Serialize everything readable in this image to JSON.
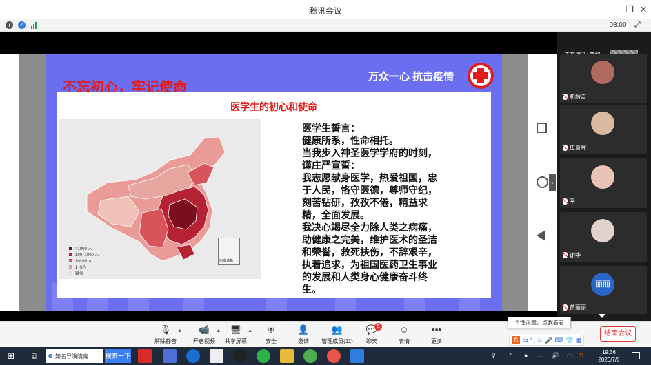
{
  "window": {
    "title": "腾讯会议"
  },
  "status": {
    "timer": "08:00"
  },
  "slide": {
    "title": "不忘初心，牢记使命",
    "slogan": "万众一心 抗击疫情",
    "panel_title": "医学生的初心和使命",
    "map_legend": [
      {
        "label": ">1000 人",
        "color": "#7a0e1e"
      },
      {
        "label": "100~1000 人",
        "color": "#b52234"
      },
      {
        "label": "10~99 人",
        "color": "#d8535a"
      },
      {
        "label": "1~9人",
        "color": "#eb9b97"
      },
      {
        "label": "疑似",
        "color": "#f6d7c9"
      }
    ],
    "inset_label": "南海诸岛",
    "oath_lines": [
      "医学生誓言：",
      "健康所系，性命相托。",
      "当我步入神圣医学学府的时刻，",
      "谨庄严宣誓：",
      "我志愿献身医学，热爱祖国，忠",
      "于人民，恪守医德，尊师守纪，",
      "刻苦钻研，孜孜不倦，精益求",
      "精，全面发展。",
      "我决心竭尽全力除人类之病痛，",
      "助健康之完美，维护医术的圣洁",
      "和荣誉，救死扶伤，不辞艰辛，",
      "执着追求，为祖国医药卫生事业",
      "的发展和人类身心健康奋斗终",
      "生。"
    ]
  },
  "sidebar": {
    "speaking_label": "正在讲话: 李旭",
    "participants": [
      {
        "name": "和娇吉",
        "avatar_color": "#b06a60"
      },
      {
        "name": "伍晋辉",
        "avatar_color": "#d9b9a2"
      },
      {
        "name": "平",
        "avatar_color": "#e8c3b8"
      },
      {
        "name": "谢华",
        "avatar_color": "#e2d2cc"
      },
      {
        "name": "黄丽丽",
        "avatar_text": "丽丽",
        "avatar_color": "#2a66c8"
      }
    ]
  },
  "toolbar": {
    "unmute": "解除静音",
    "video": "开启视频",
    "share": "共享屏幕",
    "security": "安全",
    "invite": "邀请",
    "members": "管理成员(11)",
    "chat": "聊天",
    "chat_badge": "5",
    "emoji": "表情",
    "more": "更多",
    "end": "结束会议",
    "tooltip": "个性设置，点我看看"
  },
  "ime": {
    "lang": "中"
  },
  "taskbar": {
    "search_text": "知名导演隋寓",
    "search_button": "搜索一下",
    "tray_lang": "中",
    "time": "19:36",
    "date": "2020/7/6"
  }
}
